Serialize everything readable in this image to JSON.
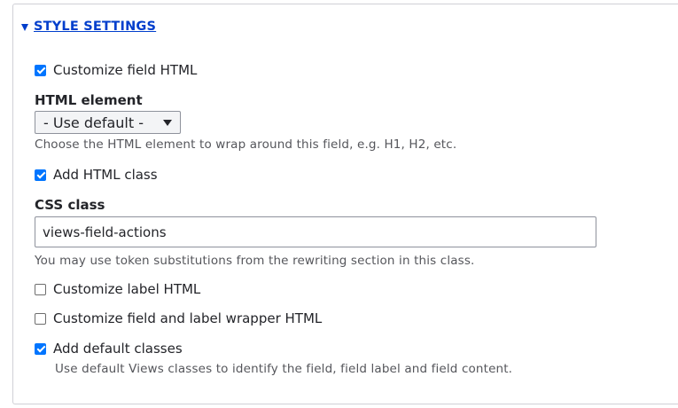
{
  "section": {
    "title": "STYLE SETTINGS"
  },
  "customize_field_html": {
    "label": "Customize field HTML",
    "checked": true
  },
  "html_element": {
    "label": "HTML element",
    "selected": "- Use default -",
    "description": "Choose the HTML element to wrap around this field, e.g. H1, H2, etc."
  },
  "add_html_class": {
    "label": "Add HTML class",
    "checked": true
  },
  "css_class": {
    "label": "CSS class",
    "value": "views-field-actions",
    "description": "You may use token substitutions from the rewriting section in this class."
  },
  "customize_label_html": {
    "label": "Customize label HTML",
    "checked": false
  },
  "customize_wrapper_html": {
    "label": "Customize field and label wrapper HTML",
    "checked": false
  },
  "add_default_classes": {
    "label": "Add default classes",
    "checked": true,
    "description": "Use default Views classes to identify the field, field label and field content."
  },
  "colors": {
    "link": "#003ecc",
    "checkbox_checked": "#0075ff",
    "text": "#232429",
    "description": "#55565b",
    "border": "#d0d0d6"
  }
}
